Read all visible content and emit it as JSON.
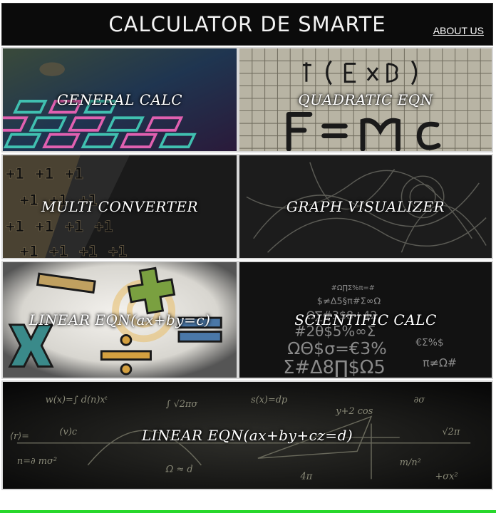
{
  "header": {
    "title": "CALCULATOR DE SMARTE",
    "about_label": "ABOUT US"
  },
  "tiles": [
    {
      "label": "GENERAL CALC"
    },
    {
      "label": "QUADRATIC EQN"
    },
    {
      "label": "MULTI CONVERTER"
    },
    {
      "label": "GRAPH VISUALIZER"
    },
    {
      "label": "LINEAR EQN(ax+by=c)"
    },
    {
      "label": "SCIENTIFIC CALC"
    },
    {
      "label": "LINEAR EQN(ax+by+cz=d)"
    }
  ],
  "colors": {
    "accent_bar": "#27d82b",
    "header_bg": "#0b0b0b"
  }
}
